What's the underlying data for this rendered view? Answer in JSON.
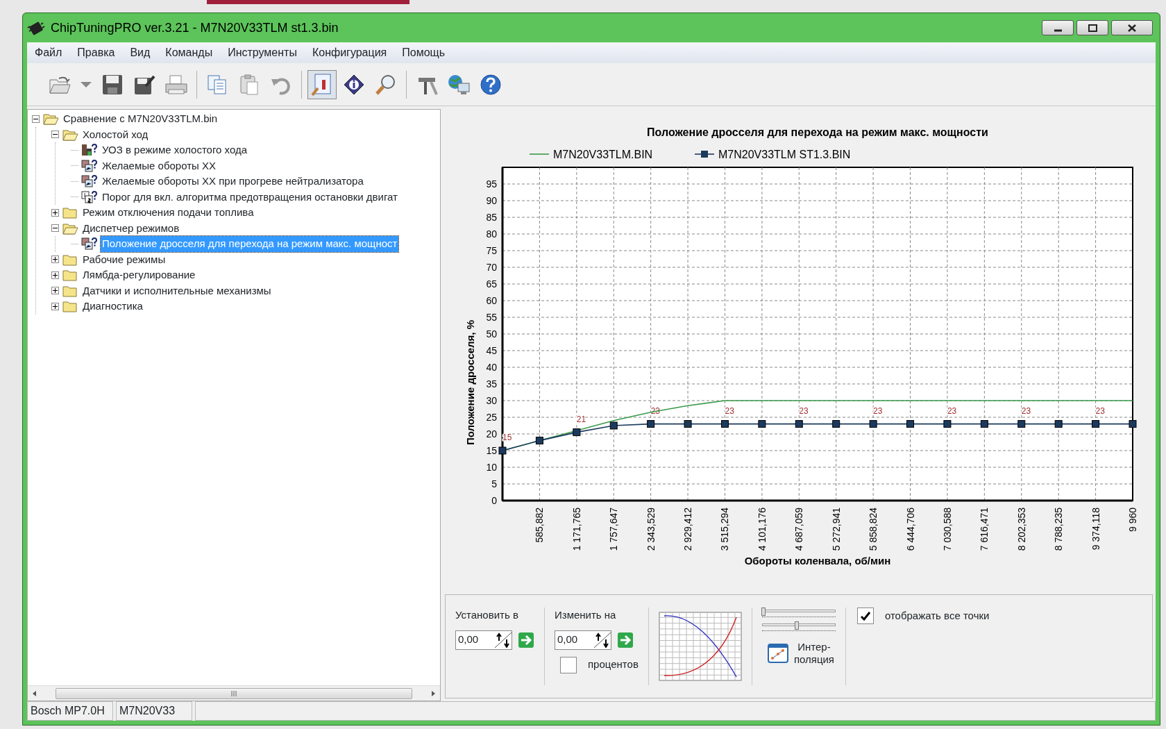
{
  "window": {
    "title": "ChipTuningPRO ver.3.21 - M7N20V33TLM st1.3.bin"
  },
  "menu": [
    "Файл",
    "Правка",
    "Вид",
    "Команды",
    "Инструменты",
    "Конфигурация",
    "Помощь"
  ],
  "toolbar": [
    {
      "kind": "open",
      "selected": false
    },
    {
      "kind": "dropdown",
      "selected": false
    },
    {
      "kind": "save",
      "selected": false
    },
    {
      "kind": "saveas",
      "selected": false
    },
    {
      "kind": "print",
      "selected": false
    },
    {
      "kind": "separator"
    },
    {
      "kind": "copy",
      "selected": false
    },
    {
      "kind": "paste",
      "selected": false
    },
    {
      "kind": "undo",
      "selected": false
    },
    {
      "kind": "separator"
    },
    {
      "kind": "chart",
      "selected": true
    },
    {
      "kind": "info",
      "selected": false
    },
    {
      "kind": "search",
      "selected": false
    },
    {
      "kind": "separator"
    },
    {
      "kind": "tools",
      "selected": false
    },
    {
      "kind": "network",
      "selected": false
    },
    {
      "kind": "help",
      "selected": false
    }
  ],
  "tree": [
    {
      "label": "Сравнение с M7N20V33TLM.bin",
      "kind": "folder",
      "expanded": true,
      "selected": false,
      "children": [
        {
          "label": "Холостой ход",
          "kind": "folder",
          "expanded": true,
          "selected": false,
          "children": [
            {
              "label": "УОЗ в режиме холостого хода",
              "kind": "map3d",
              "selected": false
            },
            {
              "label": "Желаемые обороты ХХ",
              "kind": "map2d",
              "selected": false
            },
            {
              "label": "Желаемые обороты ХХ при прогреве нейтрализатора",
              "kind": "map2d",
              "selected": false
            },
            {
              "label": "Порог для вкл. алгоритма предотвращения остановки двигат",
              "kind": "const",
              "selected": false
            }
          ]
        },
        {
          "label": "Режим отключения подачи топлива",
          "kind": "folder",
          "expanded": false,
          "selected": false
        },
        {
          "label": "Диспетчер режимов",
          "kind": "folder",
          "expanded": true,
          "selected": false,
          "children": [
            {
              "label": "Положение дросселя для перехода на режим макс. мощност",
              "kind": "map2d",
              "selected": true
            }
          ]
        },
        {
          "label": "Рабочие режимы",
          "kind": "folder",
          "expanded": false,
          "selected": false
        },
        {
          "label": "Лямбда-регулирование",
          "kind": "folder",
          "expanded": false,
          "selected": false
        },
        {
          "label": "Датчики и исполнительные механизмы",
          "kind": "folder",
          "expanded": false,
          "selected": false
        },
        {
          "label": "Диагностика",
          "kind": "folder",
          "expanded": false,
          "selected": false
        }
      ]
    }
  ],
  "chart": {
    "chart_data": {
      "type": "line",
      "title": "Положение дросселя для перехода на режим макс. мощности",
      "xlabel": "Обороты коленвала, об/мин",
      "ylabel": "Положение дросселя, %",
      "categories": [
        null,
        "585,882",
        "1 171,765",
        "1 757,647",
        "2 343,529",
        "2 929,412",
        "3 515,294",
        "4 101,176",
        "4 687,059",
        "5 272,941",
        "5 858,824",
        "6 444,706",
        "7 030,588",
        "7 616,471",
        "8 202,353",
        "8 788,235",
        "9 374,118",
        "9 960"
      ],
      "ylim": [
        0,
        100
      ],
      "grid": true,
      "legend": "top",
      "yticks": [
        0,
        5,
        10,
        15,
        20,
        25,
        30,
        35,
        40,
        45,
        50,
        55,
        60,
        65,
        70,
        75,
        80,
        85,
        90,
        95
      ],
      "series": [
        {
          "name": "M7N20V33TLM.BIN",
          "color": "#3a9a4a",
          "marker": "none",
          "values": [
            15,
            18,
            21,
            24,
            26.5,
            28.5,
            30,
            30,
            30,
            30,
            30,
            30,
            30,
            30,
            30,
            30,
            30,
            30
          ]
        },
        {
          "name": "M7N20V33TLM ST1.3.BIN",
          "color": "#1c3a5e",
          "marker": "square",
          "values": [
            15,
            18,
            20.5,
            22.5,
            23,
            23,
            23,
            23,
            23,
            23,
            23,
            23,
            23,
            23,
            23,
            23,
            23,
            23
          ],
          "value_labels": [
            "15",
            null,
            "21",
            null,
            "23",
            null,
            "23",
            null,
            "23",
            null,
            "23",
            null,
            "23",
            null,
            "23",
            null,
            "23",
            null
          ]
        }
      ]
    }
  },
  "controls": {
    "set_to": {
      "label": "Установить в",
      "value": "0,00"
    },
    "change_by": {
      "label": "Изменить на",
      "value": "0,00",
      "percent_label": "процентов",
      "percent_checked": false
    },
    "sliders": [
      {
        "level": 0.02
      },
      {
        "level": 0.47
      }
    ],
    "interpolation": {
      "label_lines": [
        "Интер-",
        "поляция"
      ]
    },
    "show_all": {
      "label": "отображать все точки",
      "checked": true
    }
  },
  "status_bar": [
    "Bosch MP7.0H",
    "M7N20V33"
  ]
}
